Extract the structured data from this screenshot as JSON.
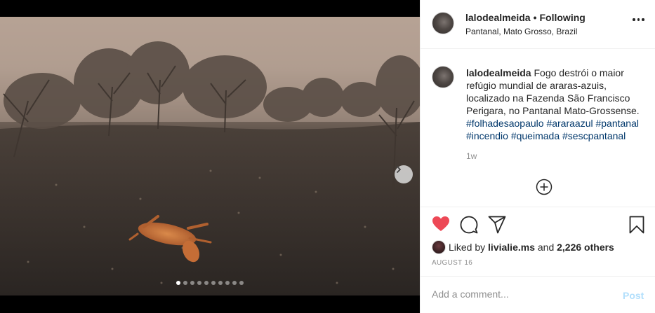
{
  "post": {
    "username": "lalodealmeida",
    "follow_separator": "•",
    "follow_status": "Following",
    "location": "Pantanal, Mato Grosso, Brazil",
    "caption_text": "Fogo destrói o maior refúgio mundial de araras-azuis, localizado na Fazenda São Francisco Perigara, no Pantanal Mato-Grossense.",
    "hashtags": [
      "#folhadesaopaulo",
      "#araraazul",
      "#pantanal",
      "#incendio",
      "#queimada",
      "#sescpantanal"
    ],
    "time_ago": "1w",
    "liked_by_prefix": "Liked by",
    "liked_by_user": "livialie.ms",
    "liked_by_and": "and",
    "others_count": "2,226 others",
    "date": "AUGUST 16",
    "comment_placeholder": "Add a comment...",
    "post_label": "Post"
  },
  "carousel": {
    "total_slides": 10,
    "active_index": 0
  },
  "icons": {
    "like": "heart-filled-icon",
    "comment": "comment-bubble-icon",
    "share": "paper-plane-icon",
    "save": "bookmark-icon",
    "more": "more-options-icon",
    "next": "chevron-right-icon",
    "load_more": "plus-circle-icon"
  },
  "colors": {
    "like_red": "#ed4956",
    "hashtag_blue": "#00376b",
    "muted_gray": "#8e8e8e",
    "post_disabled_blue": "#b2dffc"
  }
}
